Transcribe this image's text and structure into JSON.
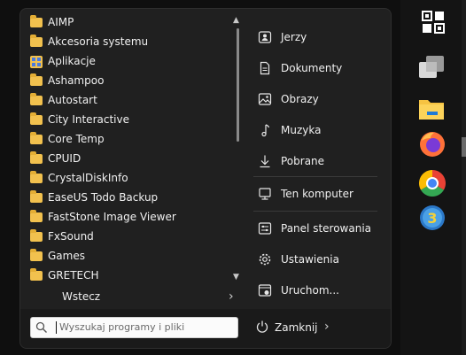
{
  "start_menu": {
    "programs": [
      {
        "label": "AIMP",
        "icon": "folder-icon"
      },
      {
        "label": "Akcesoria systemu",
        "icon": "folder-icon"
      },
      {
        "label": "Aplikacje",
        "icon": "apps-grid-icon"
      },
      {
        "label": "Ashampoo",
        "icon": "folder-icon"
      },
      {
        "label": "Autostart",
        "icon": "folder-icon"
      },
      {
        "label": "City Interactive",
        "icon": "folder-icon"
      },
      {
        "label": "Core Temp",
        "icon": "folder-icon"
      },
      {
        "label": "CPUID",
        "icon": "folder-icon"
      },
      {
        "label": "CrystalDiskInfo",
        "icon": "folder-icon"
      },
      {
        "label": "EaseUS Todo Backup",
        "icon": "folder-icon"
      },
      {
        "label": "FastStone Image Viewer",
        "icon": "folder-icon"
      },
      {
        "label": "FxSound",
        "icon": "folder-icon"
      },
      {
        "label": "Games",
        "icon": "folder-icon"
      },
      {
        "label": "GRETECH",
        "icon": "folder-icon"
      }
    ],
    "back_label": "Wstecz",
    "places": [
      {
        "label": "Jerzy",
        "icon": "user-icon"
      },
      {
        "label": "Dokumenty",
        "icon": "document-icon"
      },
      {
        "label": "Obrazy",
        "icon": "pictures-icon"
      },
      {
        "label": "Muzyka",
        "icon": "music-icon"
      },
      {
        "label": "Pobrane",
        "icon": "download-icon"
      },
      {
        "label": "Ten komputer",
        "icon": "computer-icon"
      },
      {
        "label": "Panel sterowania",
        "icon": "control-panel-icon"
      },
      {
        "label": "Ustawienia",
        "icon": "gear-icon"
      },
      {
        "label": "Uruchom...",
        "icon": "run-icon"
      }
    ],
    "search_placeholder": "Wyszukaj programy i pliki",
    "shutdown_label": "Zamknij"
  },
  "taskbar": {
    "icons": [
      "start-grid-icon",
      "task-view-icon",
      "file-explorer-icon",
      "firefox-icon",
      "chrome-icon",
      "app-3-icon"
    ]
  },
  "colors": {
    "menu_bg": "#202020",
    "folder": "#f2c14e",
    "taskbar_bg": "#141414"
  }
}
